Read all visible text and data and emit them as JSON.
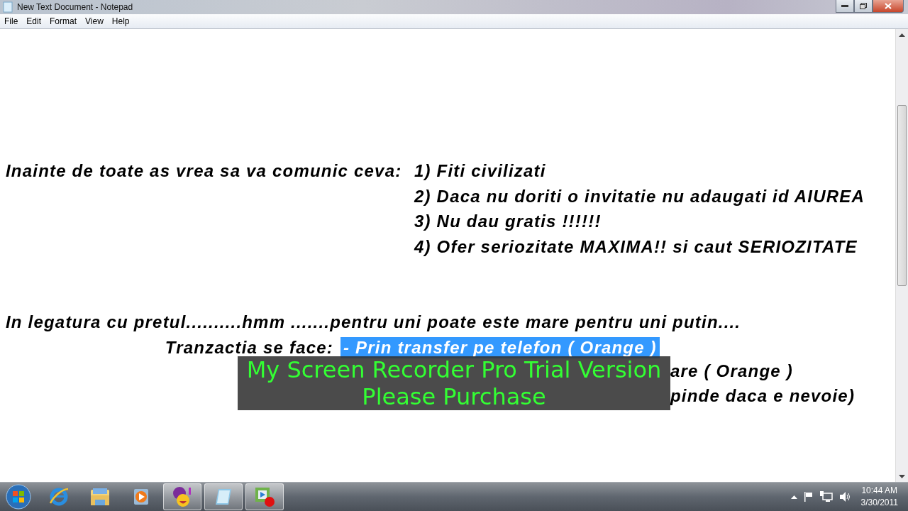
{
  "window": {
    "title": "New Text Document - Notepad"
  },
  "menu": [
    "File",
    "Edit",
    "Format",
    "View",
    "Help"
  ],
  "document": {
    "intro": {
      "lead": "Inainte de toate as vrea sa va comunic ceva:",
      "items": [
        "1) Fiti civilizati",
        "2) Daca nu doriti o invitatie nu adaugati id AIUREA",
        "3) Nu dau gratis !!!!!!",
        "4) Ofer seriozitate MAXIMA!! si caut SERIOZITATE"
      ]
    },
    "price": {
      "line": "In legatura cu pretul..........hmm .......pentru uni poate este mare pentru uni putin....",
      "lead": "Tranzactia se face:",
      "options": [
        {
          "text": "- Prin transfer pe telefon ( Orange )",
          "selected": true,
          "kind": "full"
        },
        {
          "text": "are ( Orange )",
          "selected": false,
          "kind": "covered"
        },
        {
          "text": "pinde daca e nevoie)",
          "selected": false,
          "kind": "covered"
        }
      ]
    }
  },
  "overlay": {
    "lines": [
      "My Screen Recorder Pro Trial Version",
      "Please Purchase"
    ]
  },
  "taskbar": {
    "buttons": [
      {
        "kind": "ie",
        "running": false
      },
      {
        "kind": "folder",
        "running": false
      },
      {
        "kind": "media",
        "running": false
      },
      {
        "kind": "messenger",
        "running": true
      },
      {
        "kind": "notepad",
        "running": true
      },
      {
        "kind": "recorder",
        "running": true
      }
    ],
    "clock": {
      "time": "10:44 AM",
      "date": "3/30/2011"
    }
  }
}
